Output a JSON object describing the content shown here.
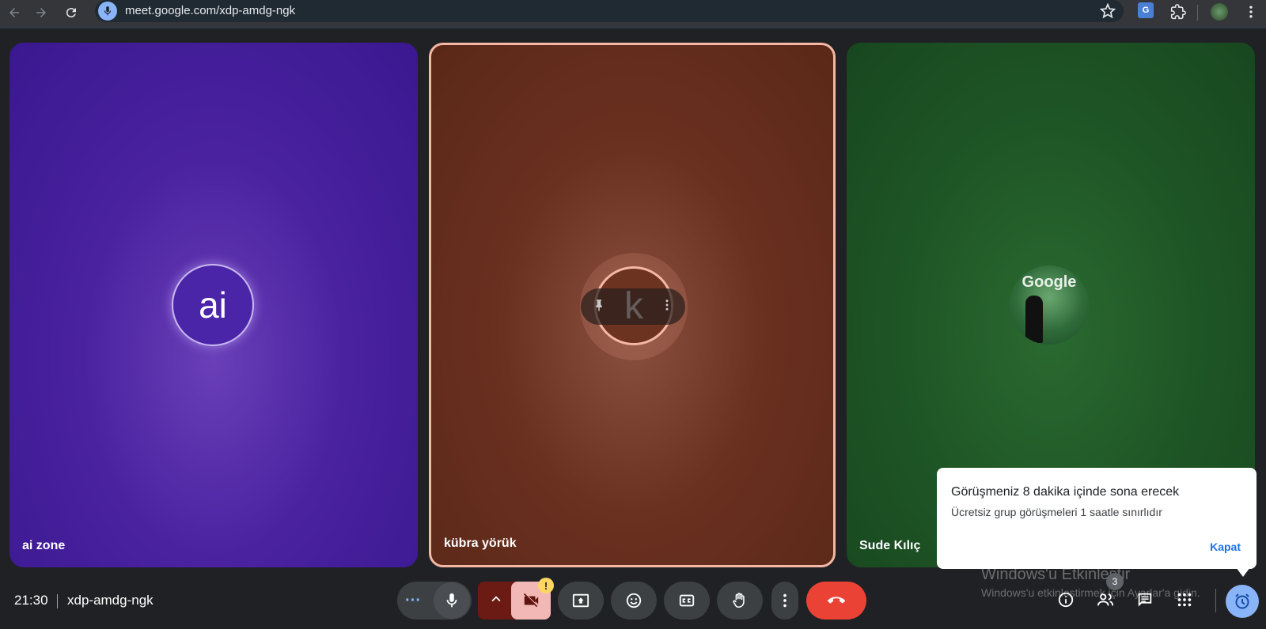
{
  "browser": {
    "url": "meet.google.com/xdp-amdg-ngk",
    "translate_ext_label": "G"
  },
  "tiles": [
    {
      "name": "ai zone",
      "initials": "ai",
      "color": "#4b25a8"
    },
    {
      "name": "kübra yörük",
      "initials": "k",
      "color": "#6b3320"
    },
    {
      "name": "Sude Kılıç",
      "photo_text": "Google",
      "color": "#1f5626"
    }
  ],
  "hover_controls": {
    "pin_icon": "pin-icon",
    "more_icon": "more-vert-icon"
  },
  "footer": {
    "time": "21:30",
    "meeting_code": "xdp-amdg-ngk",
    "more_label": "···",
    "people_count": "3",
    "warning_mark": "!",
    "leave_color": "#ea4335"
  },
  "popup": {
    "title": "Görüşmeniz 8 dakika içinde sona erecek",
    "body": "Ücretsiz grup görüşmeleri 1 saatle sınırlıdır",
    "close_label": "Kapat"
  },
  "watermark": {
    "line1": "Windows'u Etkinleştir",
    "line2": "Windows'u etkinleştirmek için Ayarlar'a gidin."
  }
}
